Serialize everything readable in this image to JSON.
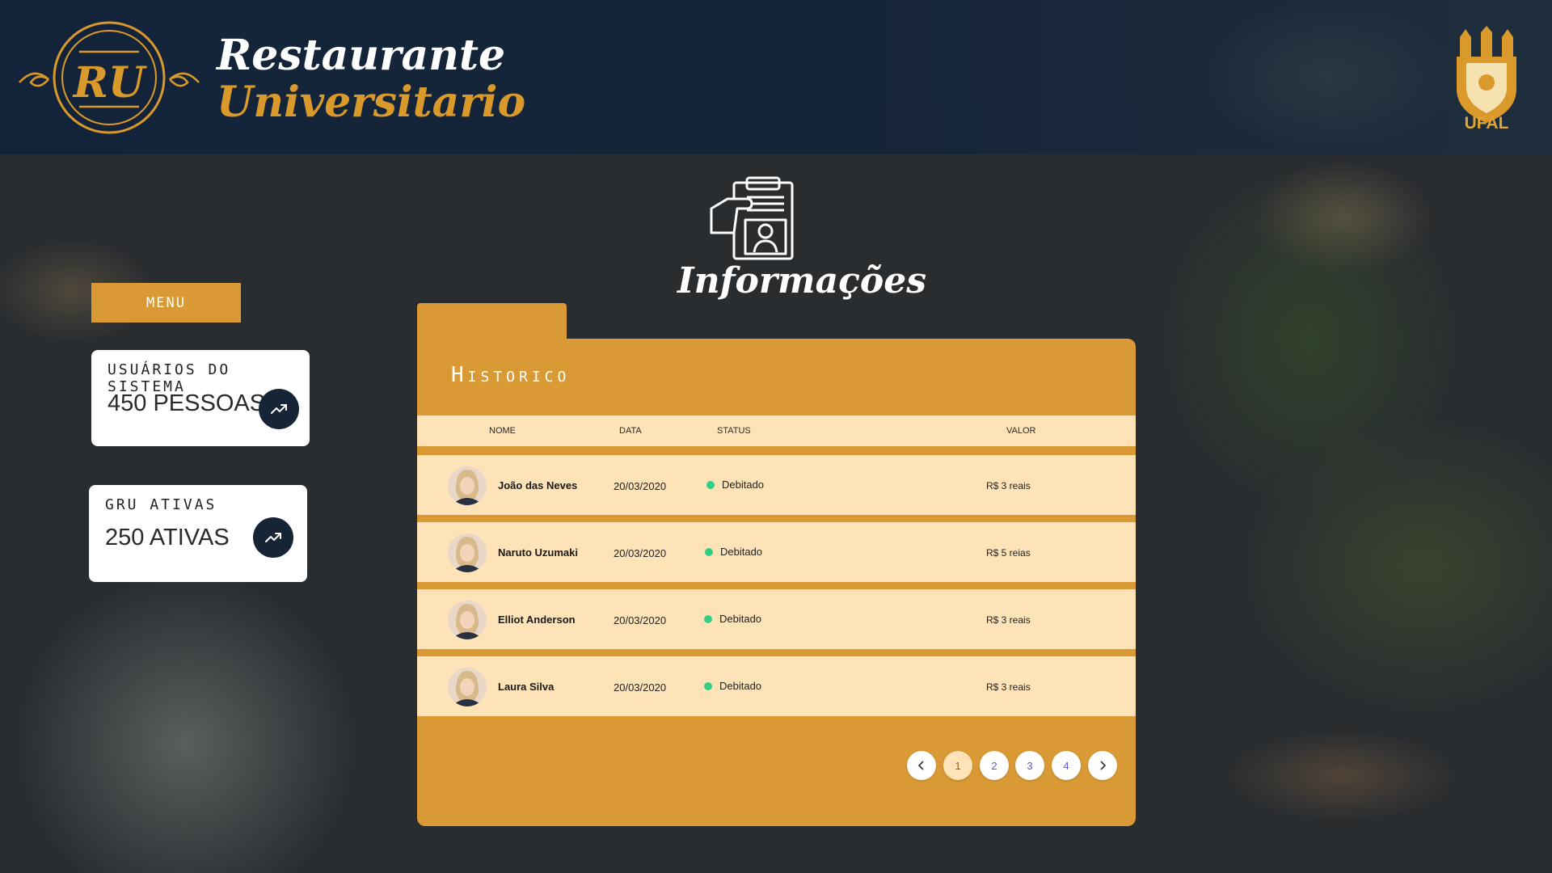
{
  "header": {
    "logo_text": "RU",
    "title_line1": "Restaurante",
    "title_line2": "Universitario",
    "partner_label": "UFAL"
  },
  "sidebar": {
    "menu_label": "MENU",
    "cards": [
      {
        "label": "USUÁRIOS DO SISTEMA",
        "value": "450 PESSOAS",
        "icon": "trending-up-icon"
      },
      {
        "label": "GRU ATIVAS",
        "value": "250 ATIVAS",
        "icon": "trending-up-icon"
      }
    ]
  },
  "main": {
    "title": "Informações",
    "icon": "clipboard-id-icon"
  },
  "history": {
    "title": "Historico",
    "columns": [
      "NOME",
      "DATA",
      "STATUS",
      "VALOR"
    ],
    "rows": [
      {
        "name": "João das Neves",
        "date": "20/03/2020",
        "status": "Debitado",
        "value": "R$ 3 reais"
      },
      {
        "name": "Naruto Uzumaki",
        "date": "20/03/2020",
        "status": "Debitado",
        "value": "R$ 5 reias"
      },
      {
        "name": "Elliot Anderson",
        "date": "20/03/2020",
        "status": "Debitado",
        "value": "R$ 3 reais"
      },
      {
        "name": "Laura Silva",
        "date": "20/03/2020",
        "status": "Debitado",
        "value": "R$ 3 reais"
      }
    ],
    "pagination": {
      "pages": [
        "1",
        "2",
        "3",
        "4"
      ],
      "current": "1"
    }
  },
  "colors": {
    "accent": "#d99a35",
    "row_bg": "#fde3b7",
    "header_bg": "#13243a",
    "status_ok": "#2fcf86",
    "page_link": "#5f57d9"
  }
}
